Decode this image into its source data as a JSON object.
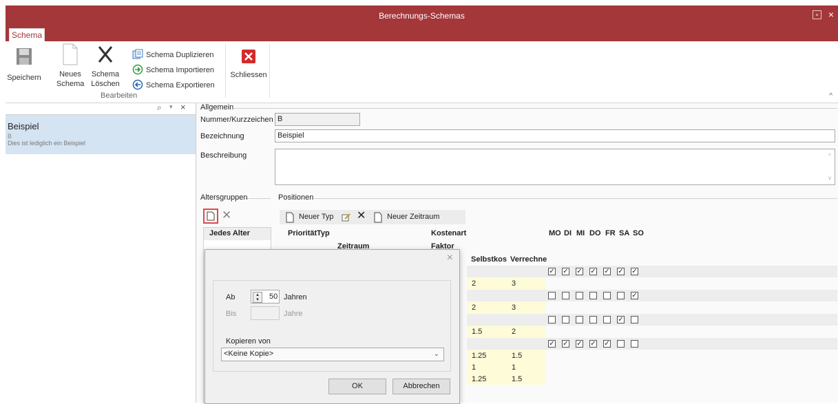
{
  "window": {
    "title": "Berechnungs-Schemas",
    "restore_icon": "restore-icon",
    "close_glyph": "×"
  },
  "tabs": [
    {
      "label": "Schema",
      "active": true
    }
  ],
  "ribbon": {
    "save_label": "Speichern",
    "new_label_1": "Neues",
    "new_label_2": "Schema",
    "delete_label_1": "Schema",
    "delete_label_2": "Löschen",
    "duplicate_label": "Schema Duplizieren",
    "import_label": "Schema Importieren",
    "export_label": "Schema Exportieren",
    "close_label": "Schliessen",
    "group_label": "Bearbeiten",
    "collapse_glyph": "^"
  },
  "search": {
    "value": "",
    "icon": "search-icon",
    "dropdown_glyph": "▾",
    "clear_glyph": "×"
  },
  "list": [
    {
      "title": "Beispiel",
      "code": "B",
      "description": "Dies ist lediglich ein Beispiel"
    }
  ],
  "form": {
    "group_title": "Allgemein",
    "code_label": "Nummer/Kurzzeichen",
    "code_value": "B",
    "name_label": "Bezeichnung",
    "name_value": "Beispiel",
    "desc_label": "Beschreibung",
    "desc_value": ""
  },
  "altersgruppen": {
    "title": "Altersgruppen",
    "items": [
      "Jedes Alter"
    ]
  },
  "positionen": {
    "title": "Positionen",
    "toolbar": {
      "new_type": "Neuer Typ",
      "new_period": "Neuer Zeitraum"
    },
    "headers": {
      "prio": "Priorität",
      "typ": "Typ",
      "zeitraum": "Zeitraum",
      "kostenart": "Kostenart",
      "faktor": "Faktor",
      "selbstkos": "Selbstkos",
      "verrechne": "Verrechne"
    },
    "days": [
      "MO",
      "DI",
      "MI",
      "DO",
      "FR",
      "SA",
      "SO"
    ],
    "day_rows": [
      [
        true,
        true,
        true,
        true,
        true,
        true,
        true
      ],
      [
        false,
        false,
        false,
        false,
        false,
        false,
        true
      ],
      [
        false,
        false,
        false,
        false,
        false,
        true,
        false
      ],
      [
        true,
        true,
        true,
        true,
        true,
        false,
        false
      ]
    ],
    "value_rows": [
      {
        "selbstkos": "2",
        "verrechne": "3"
      },
      {
        "selbstkos": "2",
        "verrechne": "3"
      },
      {
        "selbstkos": "1.5",
        "verrechne": "2"
      },
      {
        "selbstkos": "1.25",
        "verrechne": "1.5"
      },
      {
        "selbstkos": "1",
        "verrechne": "1"
      },
      {
        "selbstkos": "1.25",
        "verrechne": "1.5"
      }
    ]
  },
  "dialog": {
    "close_glyph": "×",
    "ab_label": "Ab",
    "ab_value": "50",
    "ab_unit": "Jahren",
    "bis_label": "Bis",
    "bis_value": "",
    "bis_unit": "Jahre",
    "copy_label": "Kopieren von",
    "copy_value": "<Keine Kopie>",
    "ok_label": "OK",
    "cancel_label": "Abbrechen"
  }
}
